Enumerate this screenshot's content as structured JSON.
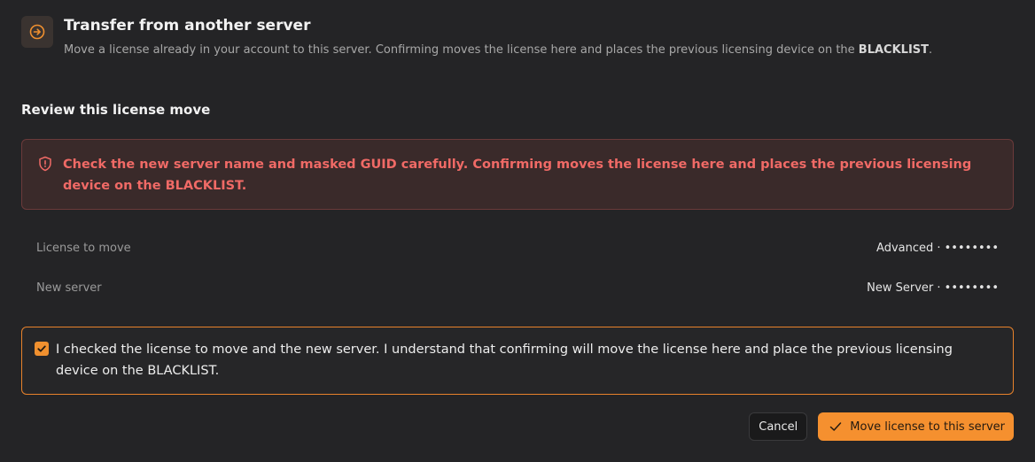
{
  "header": {
    "title": "Transfer from another server",
    "description_prefix": "Move a license already in your account to this server. Confirming moves the license here and places the previous licensing device on the ",
    "description_emphasis": "BLACKLIST",
    "description_suffix": ".",
    "icon": "arrow-circle-right-icon"
  },
  "review": {
    "title": "Review this license move"
  },
  "warning": {
    "icon": "shield-alert-icon",
    "text": "Check the new server name and masked GUID carefully. Confirming moves the license here and places the previous licensing device on the BLACKLIST."
  },
  "details": [
    {
      "label": "License to move",
      "value": "Advanced · ••••••••"
    },
    {
      "label": "New server",
      "value": "New Server · ••••••••"
    }
  ],
  "confirmation": {
    "checked": true,
    "text": "I checked the license to move and the new server. I understand that confirming will move the license here and place the previous licensing device on the BLACKLIST."
  },
  "actions": {
    "cancel_label": "Cancel",
    "confirm_label": "Move license to this server"
  },
  "colors": {
    "accent": "#f5902f",
    "warning_text": "#f06a66",
    "background": "#242426"
  }
}
